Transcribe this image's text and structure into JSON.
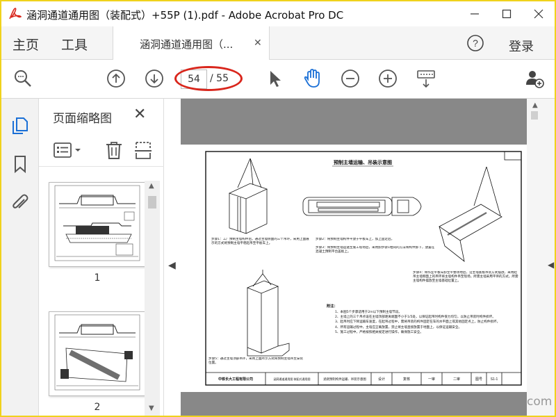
{
  "titlebar": {
    "title": "涵洞通道通用图（装配式）+55P (1).pdf - Adobe Acrobat Pro DC"
  },
  "menubar": {
    "home": "主页",
    "tools": "工具",
    "doc_tab": "涵洞通道通用图（...",
    "login": "登录"
  },
  "toolbar": {
    "current_page": "54",
    "page_total": "/ 55"
  },
  "thumbnail_panel": {
    "title": "页面缩略图",
    "thumbnails": [
      {
        "label": "1"
      },
      {
        "label": "2"
      }
    ]
  },
  "drawing": {
    "main_title": "预制主墙运输、吊装示意图",
    "step1": "步骤1：工厂预制主墙构件后，通过主墙侧面的三个吊环，采用上面展示的方式将预制主墙平稳起吊至平板车上。",
    "step2": "步骤2：将预制主墙构件平放于平板车上，加上固定后。",
    "step3": "步骤3：将预制主墙运送至施工现场后，采用卸步骤1相同的方法将构件卸下，放置在混凝土预制平台盖板上。",
    "step4": "步骤4：将作业平板车卸至平整场地后，沿主墙底板吊装方式摆放，采用起吊主墙侧面上的吊环将主墙构件吊至现场，所需主墙采用平吊的方式，所需主墙构件摆放至主墙基础位置上。",
    "step5": "步骤5：通过主墙顶部吊环，采用上面所示方式将预制主墙吊至安装位置。",
    "notes_title": "附注：",
    "notes": [
      "1、本图5个步骤适用于2m以下预制主墙节段。",
      "2、主墙上的三个吊点设在主墙顶部距离端面不小于1/5处，以保证起吊时构件受力均匀，以防止吊装时构件损坏。",
      "3、起吊时应下降运输车速度，在起吊过程中，需将吊装的构件固定在车的水平面上或其他固定点上，防止构件损坏。",
      "4、所有运输过程中，主墙应正确放置，禁止将主墙直接放置于地面上，以保证运输安全。",
      "5、施工过程中，严格按照相关规定进行操作，确保施工安全。"
    ],
    "footer": {
      "company": "中铁长大工程有限公司",
      "project": "涵洞通道通用图 装配式通用图",
      "drawing_name": "涵洞预制构件运输、吊装示意图",
      "design": "设计",
      "review": "复核",
      "first_check": "一审",
      "second_check": "二审",
      "drawing_no_label": "图号",
      "drawing_no": "S1-1"
    }
  },
  "watermark": "com",
  "colors": {
    "frame": "#f0d21c",
    "accent_blue": "#1a6fd6",
    "highlight_red": "#d9261c",
    "doc_bg": "#888888"
  },
  "icons": [
    "search-icon",
    "page-up-icon",
    "page-down-icon",
    "select-cursor-icon",
    "hand-tool-icon",
    "zoom-out-icon",
    "zoom-in-icon",
    "toolbar-dropdown-icon",
    "share-user-icon",
    "help-icon",
    "thumbnails-icon",
    "bookmark-icon",
    "attachment-icon",
    "options-menu-icon",
    "delete-icon",
    "crop-icon"
  ]
}
